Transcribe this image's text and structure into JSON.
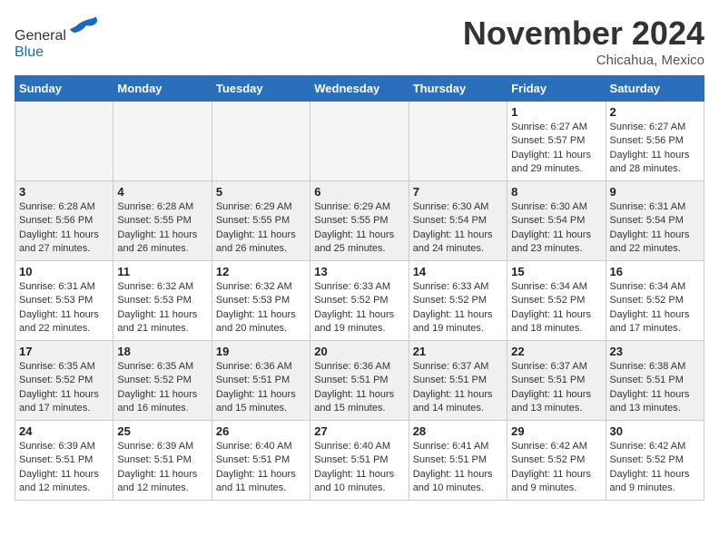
{
  "header": {
    "logo_general": "General",
    "logo_blue": "Blue",
    "month_title": "November 2024",
    "location": "Chicahua, Mexico"
  },
  "days_of_week": [
    "Sunday",
    "Monday",
    "Tuesday",
    "Wednesday",
    "Thursday",
    "Friday",
    "Saturday"
  ],
  "weeks": [
    [
      {
        "day": "",
        "info": ""
      },
      {
        "day": "",
        "info": ""
      },
      {
        "day": "",
        "info": ""
      },
      {
        "day": "",
        "info": ""
      },
      {
        "day": "",
        "info": ""
      },
      {
        "day": "1",
        "info": "Sunrise: 6:27 AM\nSunset: 5:57 PM\nDaylight: 11 hours and 29 minutes."
      },
      {
        "day": "2",
        "info": "Sunrise: 6:27 AM\nSunset: 5:56 PM\nDaylight: 11 hours and 28 minutes."
      }
    ],
    [
      {
        "day": "3",
        "info": "Sunrise: 6:28 AM\nSunset: 5:56 PM\nDaylight: 11 hours and 27 minutes."
      },
      {
        "day": "4",
        "info": "Sunrise: 6:28 AM\nSunset: 5:55 PM\nDaylight: 11 hours and 26 minutes."
      },
      {
        "day": "5",
        "info": "Sunrise: 6:29 AM\nSunset: 5:55 PM\nDaylight: 11 hours and 26 minutes."
      },
      {
        "day": "6",
        "info": "Sunrise: 6:29 AM\nSunset: 5:55 PM\nDaylight: 11 hours and 25 minutes."
      },
      {
        "day": "7",
        "info": "Sunrise: 6:30 AM\nSunset: 5:54 PM\nDaylight: 11 hours and 24 minutes."
      },
      {
        "day": "8",
        "info": "Sunrise: 6:30 AM\nSunset: 5:54 PM\nDaylight: 11 hours and 23 minutes."
      },
      {
        "day": "9",
        "info": "Sunrise: 6:31 AM\nSunset: 5:54 PM\nDaylight: 11 hours and 22 minutes."
      }
    ],
    [
      {
        "day": "10",
        "info": "Sunrise: 6:31 AM\nSunset: 5:53 PM\nDaylight: 11 hours and 22 minutes."
      },
      {
        "day": "11",
        "info": "Sunrise: 6:32 AM\nSunset: 5:53 PM\nDaylight: 11 hours and 21 minutes."
      },
      {
        "day": "12",
        "info": "Sunrise: 6:32 AM\nSunset: 5:53 PM\nDaylight: 11 hours and 20 minutes."
      },
      {
        "day": "13",
        "info": "Sunrise: 6:33 AM\nSunset: 5:52 PM\nDaylight: 11 hours and 19 minutes."
      },
      {
        "day": "14",
        "info": "Sunrise: 6:33 AM\nSunset: 5:52 PM\nDaylight: 11 hours and 19 minutes."
      },
      {
        "day": "15",
        "info": "Sunrise: 6:34 AM\nSunset: 5:52 PM\nDaylight: 11 hours and 18 minutes."
      },
      {
        "day": "16",
        "info": "Sunrise: 6:34 AM\nSunset: 5:52 PM\nDaylight: 11 hours and 17 minutes."
      }
    ],
    [
      {
        "day": "17",
        "info": "Sunrise: 6:35 AM\nSunset: 5:52 PM\nDaylight: 11 hours and 17 minutes."
      },
      {
        "day": "18",
        "info": "Sunrise: 6:35 AM\nSunset: 5:52 PM\nDaylight: 11 hours and 16 minutes."
      },
      {
        "day": "19",
        "info": "Sunrise: 6:36 AM\nSunset: 5:51 PM\nDaylight: 11 hours and 15 minutes."
      },
      {
        "day": "20",
        "info": "Sunrise: 6:36 AM\nSunset: 5:51 PM\nDaylight: 11 hours and 15 minutes."
      },
      {
        "day": "21",
        "info": "Sunrise: 6:37 AM\nSunset: 5:51 PM\nDaylight: 11 hours and 14 minutes."
      },
      {
        "day": "22",
        "info": "Sunrise: 6:37 AM\nSunset: 5:51 PM\nDaylight: 11 hours and 13 minutes."
      },
      {
        "day": "23",
        "info": "Sunrise: 6:38 AM\nSunset: 5:51 PM\nDaylight: 11 hours and 13 minutes."
      }
    ],
    [
      {
        "day": "24",
        "info": "Sunrise: 6:39 AM\nSunset: 5:51 PM\nDaylight: 11 hours and 12 minutes."
      },
      {
        "day": "25",
        "info": "Sunrise: 6:39 AM\nSunset: 5:51 PM\nDaylight: 11 hours and 12 minutes."
      },
      {
        "day": "26",
        "info": "Sunrise: 6:40 AM\nSunset: 5:51 PM\nDaylight: 11 hours and 11 minutes."
      },
      {
        "day": "27",
        "info": "Sunrise: 6:40 AM\nSunset: 5:51 PM\nDaylight: 11 hours and 10 minutes."
      },
      {
        "day": "28",
        "info": "Sunrise: 6:41 AM\nSunset: 5:51 PM\nDaylight: 11 hours and 10 minutes."
      },
      {
        "day": "29",
        "info": "Sunrise: 6:42 AM\nSunset: 5:52 PM\nDaylight: 11 hours and 9 minutes."
      },
      {
        "day": "30",
        "info": "Sunrise: 6:42 AM\nSunset: 5:52 PM\nDaylight: 11 hours and 9 minutes."
      }
    ]
  ]
}
